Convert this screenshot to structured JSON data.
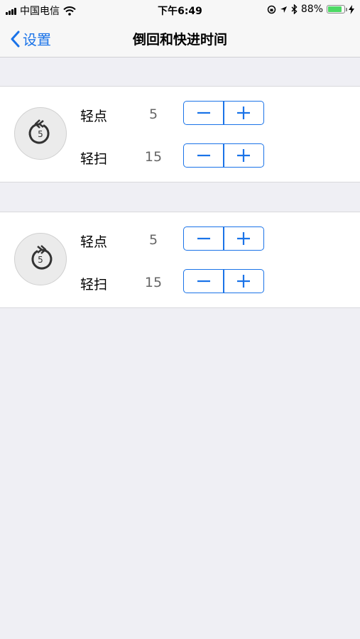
{
  "status_bar": {
    "carrier": "中国电信",
    "time": "下午6:49",
    "battery_percent": "88%",
    "battery_level": 0.88
  },
  "nav": {
    "back_label": "设置",
    "title": "倒回和快进时间"
  },
  "rewind": {
    "icon_number": "5",
    "rows": [
      {
        "label": "轻点",
        "value": "5"
      },
      {
        "label": "轻扫",
        "value": "15"
      }
    ]
  },
  "forward": {
    "icon_number": "5",
    "rows": [
      {
        "label": "轻点",
        "value": "5"
      },
      {
        "label": "轻扫",
        "value": "15"
      }
    ]
  },
  "colors": {
    "accent": "#1a73e8",
    "background": "#efeff4",
    "battery": "#4cd964"
  }
}
